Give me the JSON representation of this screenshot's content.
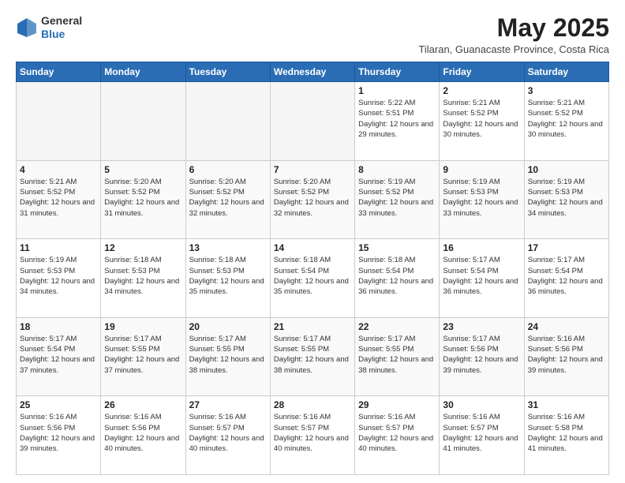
{
  "header": {
    "logo_line1": "General",
    "logo_line2": "Blue",
    "month_year": "May 2025",
    "location": "Tilaran, Guanacaste Province, Costa Rica"
  },
  "days_of_week": [
    "Sunday",
    "Monday",
    "Tuesday",
    "Wednesday",
    "Thursday",
    "Friday",
    "Saturday"
  ],
  "weeks": [
    [
      {
        "day": "",
        "empty": true
      },
      {
        "day": "",
        "empty": true
      },
      {
        "day": "",
        "empty": true
      },
      {
        "day": "",
        "empty": true
      },
      {
        "day": "1",
        "sunrise": "5:22 AM",
        "sunset": "5:51 PM",
        "daylight": "12 hours and 29 minutes."
      },
      {
        "day": "2",
        "sunrise": "5:21 AM",
        "sunset": "5:52 PM",
        "daylight": "12 hours and 30 minutes."
      },
      {
        "day": "3",
        "sunrise": "5:21 AM",
        "sunset": "5:52 PM",
        "daylight": "12 hours and 30 minutes."
      }
    ],
    [
      {
        "day": "4",
        "sunrise": "5:21 AM",
        "sunset": "5:52 PM",
        "daylight": "12 hours and 31 minutes."
      },
      {
        "day": "5",
        "sunrise": "5:20 AM",
        "sunset": "5:52 PM",
        "daylight": "12 hours and 31 minutes."
      },
      {
        "day": "6",
        "sunrise": "5:20 AM",
        "sunset": "5:52 PM",
        "daylight": "12 hours and 32 minutes."
      },
      {
        "day": "7",
        "sunrise": "5:20 AM",
        "sunset": "5:52 PM",
        "daylight": "12 hours and 32 minutes."
      },
      {
        "day": "8",
        "sunrise": "5:19 AM",
        "sunset": "5:52 PM",
        "daylight": "12 hours and 33 minutes."
      },
      {
        "day": "9",
        "sunrise": "5:19 AM",
        "sunset": "5:53 PM",
        "daylight": "12 hours and 33 minutes."
      },
      {
        "day": "10",
        "sunrise": "5:19 AM",
        "sunset": "5:53 PM",
        "daylight": "12 hours and 34 minutes."
      }
    ],
    [
      {
        "day": "11",
        "sunrise": "5:19 AM",
        "sunset": "5:53 PM",
        "daylight": "12 hours and 34 minutes."
      },
      {
        "day": "12",
        "sunrise": "5:18 AM",
        "sunset": "5:53 PM",
        "daylight": "12 hours and 34 minutes."
      },
      {
        "day": "13",
        "sunrise": "5:18 AM",
        "sunset": "5:53 PM",
        "daylight": "12 hours and 35 minutes."
      },
      {
        "day": "14",
        "sunrise": "5:18 AM",
        "sunset": "5:54 PM",
        "daylight": "12 hours and 35 minutes."
      },
      {
        "day": "15",
        "sunrise": "5:18 AM",
        "sunset": "5:54 PM",
        "daylight": "12 hours and 36 minutes."
      },
      {
        "day": "16",
        "sunrise": "5:17 AM",
        "sunset": "5:54 PM",
        "daylight": "12 hours and 36 minutes."
      },
      {
        "day": "17",
        "sunrise": "5:17 AM",
        "sunset": "5:54 PM",
        "daylight": "12 hours and 36 minutes."
      }
    ],
    [
      {
        "day": "18",
        "sunrise": "5:17 AM",
        "sunset": "5:54 PM",
        "daylight": "12 hours and 37 minutes."
      },
      {
        "day": "19",
        "sunrise": "5:17 AM",
        "sunset": "5:55 PM",
        "daylight": "12 hours and 37 minutes."
      },
      {
        "day": "20",
        "sunrise": "5:17 AM",
        "sunset": "5:55 PM",
        "daylight": "12 hours and 38 minutes."
      },
      {
        "day": "21",
        "sunrise": "5:17 AM",
        "sunset": "5:55 PM",
        "daylight": "12 hours and 38 minutes."
      },
      {
        "day": "22",
        "sunrise": "5:17 AM",
        "sunset": "5:55 PM",
        "daylight": "12 hours and 38 minutes."
      },
      {
        "day": "23",
        "sunrise": "5:17 AM",
        "sunset": "5:56 PM",
        "daylight": "12 hours and 39 minutes."
      },
      {
        "day": "24",
        "sunrise": "5:16 AM",
        "sunset": "5:56 PM",
        "daylight": "12 hours and 39 minutes."
      }
    ],
    [
      {
        "day": "25",
        "sunrise": "5:16 AM",
        "sunset": "5:56 PM",
        "daylight": "12 hours and 39 minutes."
      },
      {
        "day": "26",
        "sunrise": "5:16 AM",
        "sunset": "5:56 PM",
        "daylight": "12 hours and 40 minutes."
      },
      {
        "day": "27",
        "sunrise": "5:16 AM",
        "sunset": "5:57 PM",
        "daylight": "12 hours and 40 minutes."
      },
      {
        "day": "28",
        "sunrise": "5:16 AM",
        "sunset": "5:57 PM",
        "daylight": "12 hours and 40 minutes."
      },
      {
        "day": "29",
        "sunrise": "5:16 AM",
        "sunset": "5:57 PM",
        "daylight": "12 hours and 40 minutes."
      },
      {
        "day": "30",
        "sunrise": "5:16 AM",
        "sunset": "5:57 PM",
        "daylight": "12 hours and 41 minutes."
      },
      {
        "day": "31",
        "sunrise": "5:16 AM",
        "sunset": "5:58 PM",
        "daylight": "12 hours and 41 minutes."
      }
    ]
  ],
  "labels": {
    "sunrise": "Sunrise:",
    "sunset": "Sunset:",
    "daylight": "Daylight:"
  }
}
